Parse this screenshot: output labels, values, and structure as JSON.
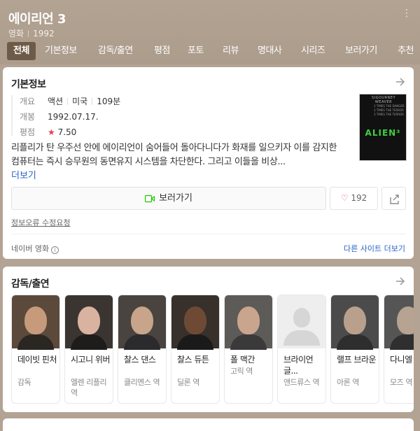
{
  "header": {
    "title": "에이리언 3",
    "category": "영화",
    "year": "1992",
    "tabs": [
      "전체",
      "기본정보",
      "감독/출연",
      "평점",
      "포토",
      "리뷰",
      "명대사",
      "시리즈",
      "보러가기",
      "추천"
    ]
  },
  "basic_info": {
    "section_title": "기본정보",
    "overview_label": "개요",
    "genre": "액션",
    "country": "미국",
    "runtime": "109분",
    "release_label": "개봉",
    "release_date": "1992.07.17.",
    "rating_label": "평점",
    "rating_star": "★",
    "rating_value": "7.50",
    "poster_tagline": "SIGOURNEY WEAVER",
    "poster_lines": [
      "3 TIMES THE DANGER",
      "3 TIMES THE TERROR",
      "3 TIMES THE TERROR"
    ],
    "poster_logo": "ALIEN³",
    "synopsis": "리플리가 탄 우주선 안에 에이리언이 숨어들어 돌아다니다가 화재를 일으키자 이를 감지한 컴퓨터는 즉시 승무원의 동면유지 시스템을 차단한다. 그리고 이들을 비상...",
    "more_label": "더보기",
    "watch_label": "보러가기",
    "like_count": "192",
    "report_label": "정보오류 수정요청",
    "source_label": "네이버 영화",
    "info_icon": "i",
    "other_sites_label": "다른 사이트 더보기",
    "accent_color": "#2a62c8",
    "star_color": "#e2434e"
  },
  "cast": {
    "section_title": "감독/출연",
    "people": [
      {
        "name": "데이빗 핀처",
        "role": "감독"
      },
      {
        "name": "시고니 위버",
        "role": "엘렌 리플리 역"
      },
      {
        "name": "찰스 댄스",
        "role": "클리멘스 역"
      },
      {
        "name": "찰스 듀튼",
        "role": "딜론 역"
      },
      {
        "name": "폴 맥간",
        "role": "고릭 역"
      },
      {
        "name": "브라이언 글...",
        "role": "앤드류스 역"
      },
      {
        "name": "랠프 브라운",
        "role": "아론 역"
      },
      {
        "name": "다니엘 웹",
        "role": "모즈 역"
      }
    ]
  }
}
